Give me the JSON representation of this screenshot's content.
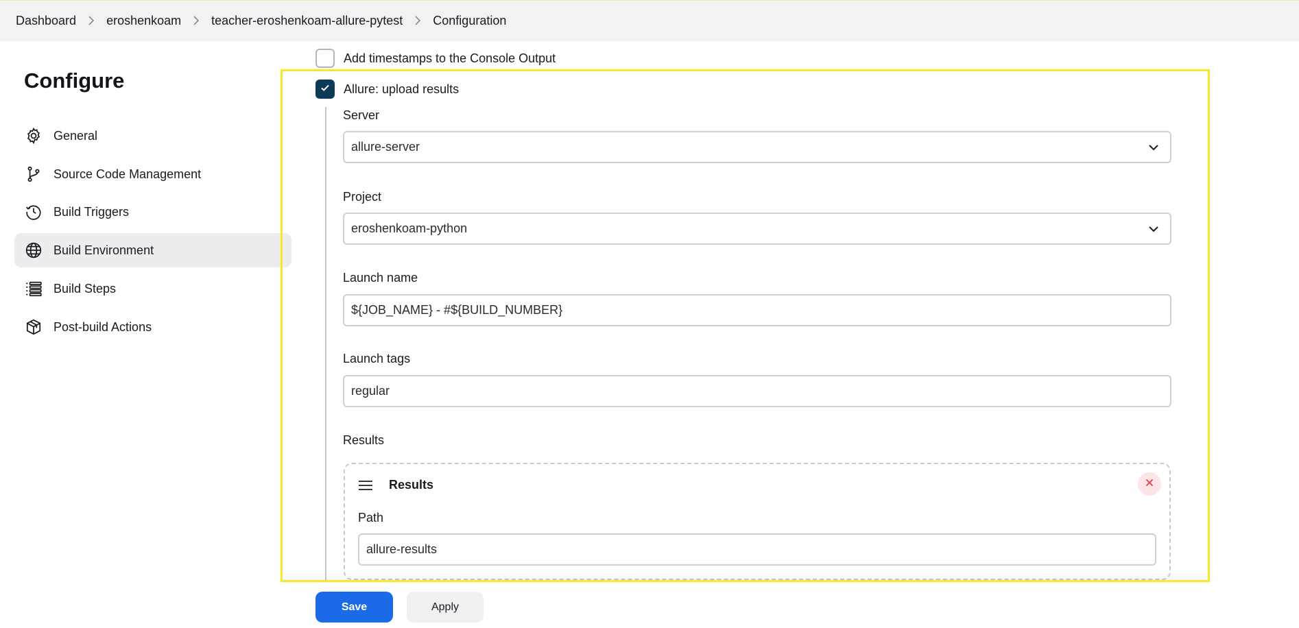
{
  "breadcrumb": [
    "Dashboard",
    "eroshenkoam",
    "teacher-eroshenkoam-allure-pytest",
    "Configuration"
  ],
  "sidebar": {
    "title": "Configure",
    "items": [
      {
        "label": "General",
        "icon": "gear-icon"
      },
      {
        "label": "Source Code Management",
        "icon": "branch-icon"
      },
      {
        "label": "Build Triggers",
        "icon": "clock-icon"
      },
      {
        "label": "Build Environment",
        "icon": "globe-icon",
        "active": true
      },
      {
        "label": "Build Steps",
        "icon": "list-icon"
      },
      {
        "label": "Post-build Actions",
        "icon": "package-icon"
      }
    ]
  },
  "form": {
    "timestamps_label": "Add timestamps to the Console Output",
    "allure_label": "Allure: upload results",
    "server_label": "Server",
    "server_value": "allure-server",
    "project_label": "Project",
    "project_value": "eroshenkoam-python",
    "launch_name_label": "Launch name",
    "launch_name_value": "${JOB_NAME} - #${BUILD_NUMBER}",
    "launch_tags_label": "Launch tags",
    "launch_tags_value": "regular",
    "results_label": "Results",
    "results_block_title": "Results",
    "path_label": "Path",
    "path_value": "allure-results"
  },
  "buttons": {
    "save": "Save",
    "apply": "Apply"
  },
  "colors": {
    "accent": "#1b6ae8",
    "checkbox": "#0d3a56",
    "highlight": "#f5e92a"
  }
}
